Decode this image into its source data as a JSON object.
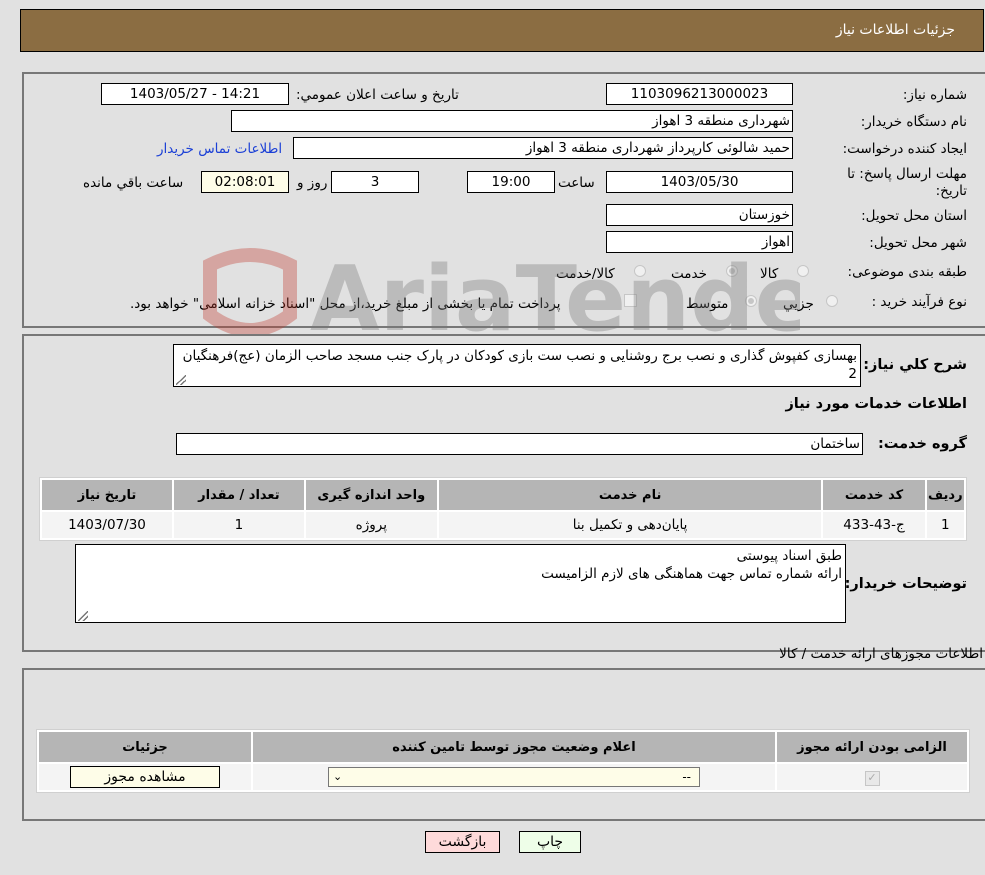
{
  "header": {
    "title": "جزئیات اطلاعات نیاز"
  },
  "need_info": {
    "need_number_label": "شماره نیاز:",
    "need_number": "1103096213000023",
    "announce_label": "تاریخ و ساعت اعلان عمومي:",
    "announce_value": "1403/05/27 - 14:21",
    "buyer_org_label": "نام دستگاه خریدار:",
    "buyer_org": "شهرداری منطقه 3 اهواز",
    "creator_label": "ایجاد کننده درخواست:",
    "creator": "حمید شالوئی کارپرداز شهرداری منطقه 3 اهواز",
    "buyer_contact_link": "اطلاعات تماس خریدار",
    "deadline_label": "مهلت ارسال پاسخ: تا تاریخ:",
    "deadline_date": "1403/05/30",
    "time_label": "ساعت",
    "deadline_time": "19:00",
    "days_value": "3",
    "days_label": "روز و",
    "remaining_time": "02:08:01",
    "remaining_label": "ساعت باقي مانده",
    "province_label": "استان محل تحویل:",
    "province": "خوزستان",
    "city_label": "شهر محل تحویل:",
    "city": "اهواز",
    "category_label": "طبقه بندی موضوعی:",
    "category_options": [
      {
        "label": "کالا",
        "checked": false
      },
      {
        "label": "خدمت",
        "checked": true
      },
      {
        "label": "کالا/خدمت",
        "checked": false
      }
    ],
    "process_label": "نوع فرآیند خرید :",
    "process_options": [
      {
        "label": "جزيي",
        "checked": false
      },
      {
        "label": "متوسط",
        "checked": true
      }
    ],
    "treasury_note": "پرداخت تمام یا بخشی از مبلغ خرید،از محل \"اسناد خزانه اسلامی\" خواهد بود.",
    "treasury_checked": false
  },
  "description": {
    "label": "شرح کلي نیاز:",
    "text": "بهسازی کفپوش گذاری و نصب برج روشنایی و نصب ست بازی کودکان در پارک جنب مسجد صاحب الزمان (عج)فرهنگیان 2"
  },
  "services": {
    "section_title": "اطلاعات خدمات مورد نیاز",
    "group_label": "گروه خدمت:",
    "group_value": "ساختمان",
    "columns": [
      "ردیف",
      "کد خدمت",
      "نام خدمت",
      "واحد اندازه گیری",
      "تعداد / مقدار",
      "تاریخ نیاز"
    ],
    "rows": [
      [
        "1",
        "ج-43-433",
        "پایان‌دهی و تکمیل بنا",
        "پروژه",
        "1",
        "1403/07/30"
      ]
    ]
  },
  "buyer_notes": {
    "label": "توضیحات خریدار:",
    "line1": "طبق اسناد پیوستی",
    "line2": "ارائه شماره تماس جهت هماهنگی های لازم الزامیست"
  },
  "permits": {
    "section_title": "اطلاعات مجوزهای ارائه خدمت / کالا",
    "columns": [
      "الزامی بودن ارائه مجوز",
      "اعلام وضعیت مجوز توسط تامین کننده",
      "جزئیات"
    ],
    "row": {
      "required_checked": true,
      "status_value": "--",
      "details_button": "مشاهده مجوز"
    }
  },
  "footer": {
    "print_label": "چاپ",
    "back_label": "بازگشت"
  },
  "watermark": {
    "text": "AriaTender.neT"
  }
}
